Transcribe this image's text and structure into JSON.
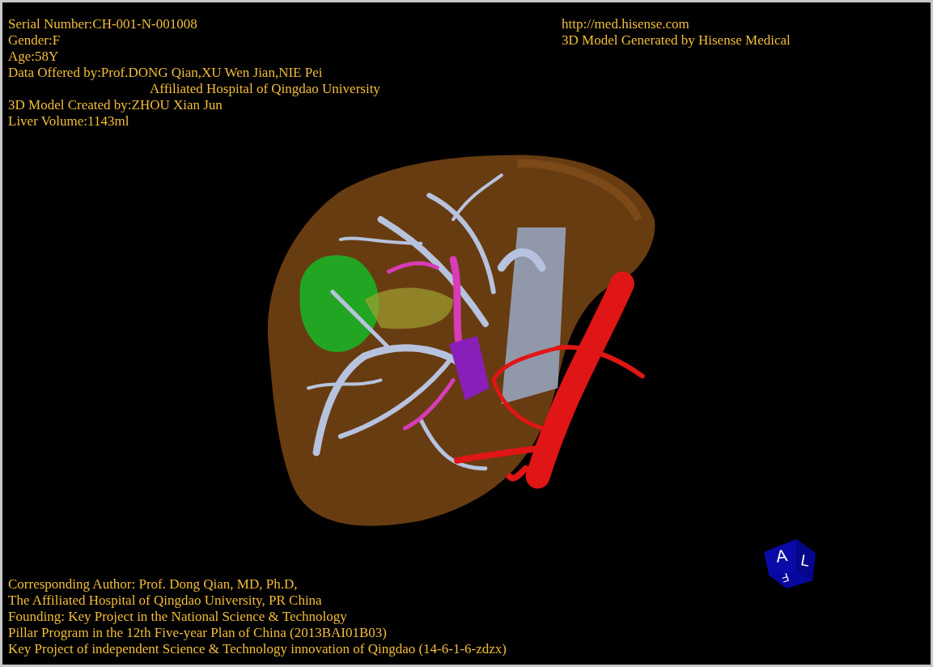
{
  "patient_info": [
    {
      "text": "Serial Number:CH-001-N-001008",
      "kind": "line"
    },
    {
      "text": "Gender:F",
      "kind": "line"
    },
    {
      "text": "Age:58Y",
      "kind": "line"
    },
    {
      "text": "Data Offered by:Prof.DONG Qian,XU Wen Jian,NIE Pei",
      "kind": "line"
    },
    {
      "text": "Affiliated Hospital of Qingdao University",
      "kind": "indent"
    },
    {
      "text": "3D Model Created by:ZHOU Xian Jun",
      "kind": "line"
    },
    {
      "text": "Liver Volume:1143ml",
      "kind": "line"
    }
  ],
  "vendor_info": [
    "http://med.hisense.com",
    "3D Model Generated by Hisense Medical"
  ],
  "credits": [
    "Corresponding Author: Prof. Dong Qian, MD, Ph.D,",
    "The Affiliated Hospital of Qingdao University, PR China",
    "Founding: Key Project in the National Science & Technology",
    "Pillar Program in the 12th Five-year Plan of China (2013BAI01B03)",
    "Key Project of independent Science & Technology innovation of Qingdao (14-6-1-6-zdzx)"
  ],
  "orientation_cube": {
    "labels": [
      "A",
      "L",
      "F"
    ]
  }
}
